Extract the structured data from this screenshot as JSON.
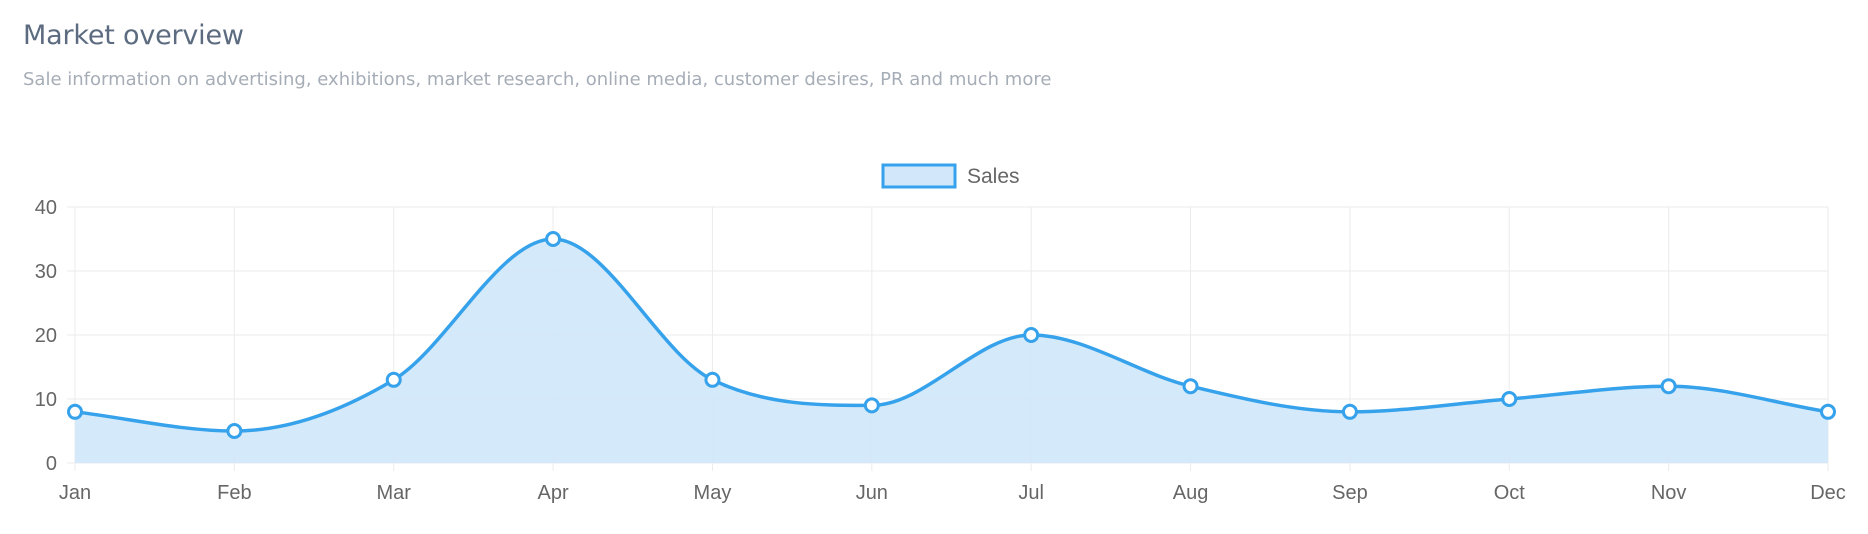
{
  "header": {
    "title": "Market overview",
    "subtitle": "Sale information on advertising, exhibitions, market research, online media, customer desires, PR and much more"
  },
  "chart_data": {
    "type": "area",
    "categories": [
      "Jan",
      "Feb",
      "Mar",
      "Apr",
      "May",
      "Jun",
      "Jul",
      "Aug",
      "Sep",
      "Oct",
      "Nov",
      "Dec"
    ],
    "series": [
      {
        "name": "Sales",
        "values": [
          8,
          5,
          13,
          35,
          13,
          9,
          20,
          12,
          8,
          10,
          12,
          8
        ]
      }
    ],
    "ylim": [
      0,
      40
    ],
    "yticks": [
      0,
      10,
      20,
      30,
      40
    ],
    "grid": true,
    "legend_position": "top-center",
    "colors": {
      "line": "#36a2eb",
      "fill": "#d2e8fa",
      "grid": "#ebebeb",
      "tick_text": "#666666"
    }
  }
}
